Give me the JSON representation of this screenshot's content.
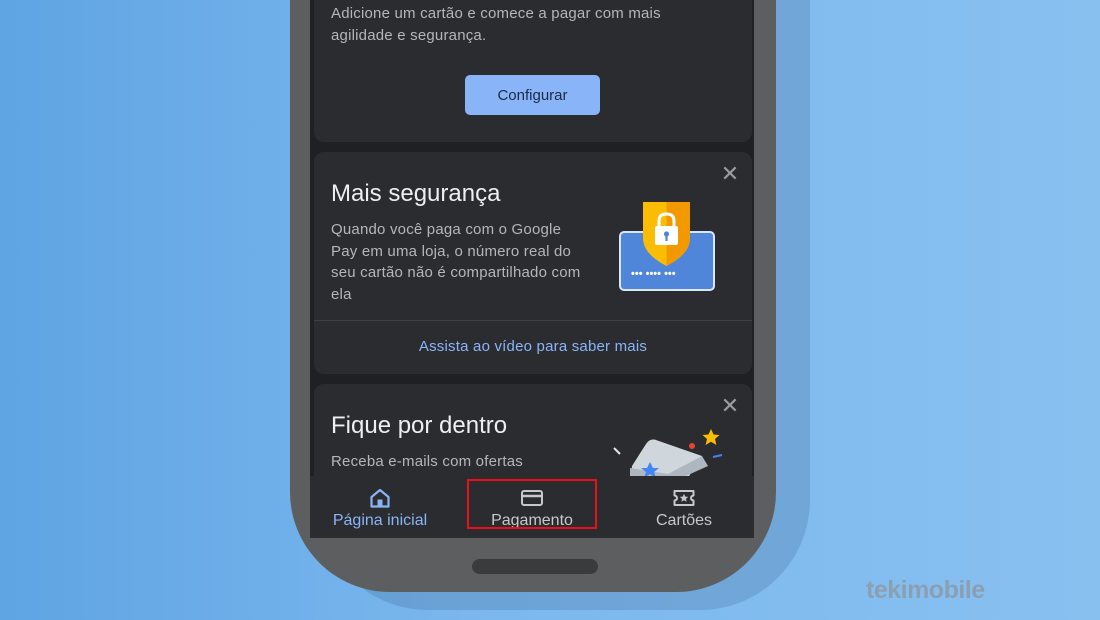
{
  "setup_card": {
    "text": "Adicione um cartão e comece a pagar com mais agilidade e segurança.",
    "button_label": "Configurar"
  },
  "security_card": {
    "title": "Mais segurança",
    "text": "Quando você paga com o Google Pay em uma loja, o número real do seu cartão não é compartilhado com ela",
    "close_glyph": "✕",
    "card_dots": "••• •••• •••",
    "link_label": "Assista ao vídeo para saber mais"
  },
  "news_card": {
    "title": "Fique por dentro",
    "text": "Receba e-mails com ofertas",
    "close_glyph": "✕"
  },
  "nav": {
    "items": [
      {
        "label": "Página inicial",
        "icon": "home-icon",
        "active": true
      },
      {
        "label": "Pagamento",
        "icon": "card-icon",
        "active": false
      },
      {
        "label": "Cartões",
        "icon": "ticket-star-icon",
        "active": false
      }
    ]
  },
  "watermark": "tekimobile",
  "colors": {
    "accent": "#8ab4f8",
    "card_bg": "#2b2c30",
    "screen_bg": "#1f2023",
    "highlight": "#e8121e",
    "shield": "#fbbc04",
    "payment_card": "#4f86d9"
  }
}
